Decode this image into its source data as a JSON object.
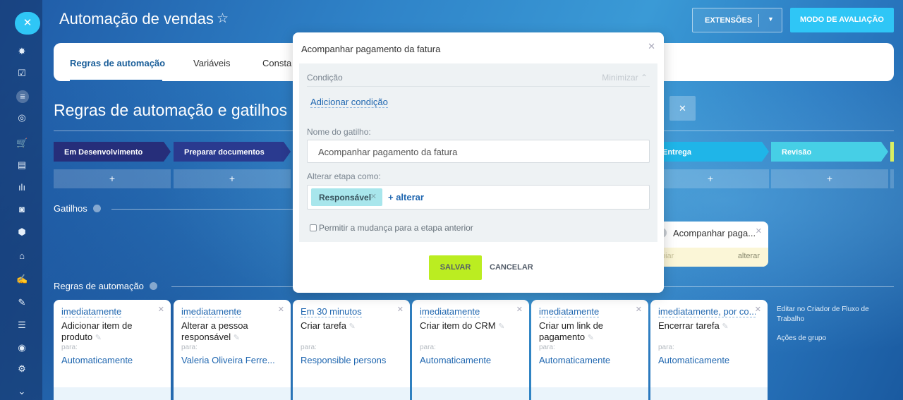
{
  "header": {
    "title": "Automação de vendas",
    "extensions_label": "EXTENSÕES",
    "evaluation_label": "MODO DE AVALIAÇÃO"
  },
  "tabs": [
    "Regras de automação",
    "Variáveis",
    "Consta"
  ],
  "section_title": "Regras de automação e gatilhos",
  "stages": [
    {
      "label": "Em Desenvolvimento",
      "color": "#262e7a"
    },
    {
      "label": "Preparar documentos",
      "color": "#2a3a8f"
    },
    {
      "label": "Entrega",
      "color": "#1fb5e8"
    },
    {
      "label": "Revisão",
      "color": "#46cfe6"
    }
  ],
  "stage_add": "+",
  "triggers": {
    "label": "Gatilhos",
    "card": {
      "title": "Acompanhar paga...",
      "copy": "piar",
      "change": "alterar"
    }
  },
  "rules_label": "Regras de automação",
  "rules": [
    {
      "when": "imediatamente",
      "name": "Adicionar item de produto",
      "para": "para:",
      "who": "Automaticamente"
    },
    {
      "when": "imediatamente",
      "name": "Alterar a pessoa responsável",
      "para": "para:",
      "who": "Valeria Oliveira Ferre..."
    },
    {
      "when": "Em 30 minutos",
      "name": "Criar tarefa",
      "para": "para:",
      "who": "Responsible persons"
    },
    {
      "when": "imediatamente",
      "name": "Criar item do CRM",
      "para": "para:",
      "who": "Automaticamente"
    },
    {
      "when": "imediatamente",
      "name": "Criar um link de pagamento",
      "para": "para:",
      "who": "Automaticamente"
    },
    {
      "when": "imediatamente, por co...",
      "name": "Encerrar tarefa",
      "para": "para:",
      "who": "Automaticamente"
    }
  ],
  "side_links": {
    "flow": "Editar no Criador de Fluxo de Trabalho",
    "group": "Ações de grupo"
  },
  "modal": {
    "title": "Acompanhar pagamento da fatura",
    "condition": "Condição",
    "minimize": "Minimizar",
    "add_condition": "Adicionar condição",
    "trigger_name_label": "Nome do gatilho:",
    "trigger_name_value": "Acompanhar pagamento da fatura",
    "change_stage_label": "Alterar etapa como:",
    "chip": "Responsável",
    "alter": "+ alterar",
    "checkbox": "Permitir a mudança para a etapa anterior",
    "save": "SALVAR",
    "cancel": "CANCELAR"
  }
}
